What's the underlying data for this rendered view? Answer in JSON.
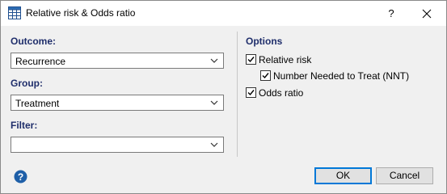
{
  "window": {
    "title": "Relative risk & Odds ratio",
    "help_label": "?"
  },
  "left": {
    "outcome": {
      "label": "Outcome:",
      "value": "Recurrence"
    },
    "group": {
      "label": "Group:",
      "value": "Treatment"
    },
    "filter": {
      "label": "Filter:",
      "value": ""
    }
  },
  "options": {
    "heading": "Options",
    "items": [
      {
        "label": "Relative risk",
        "checked": true
      },
      {
        "label": "Number Needed to Treat (NNT)",
        "checked": true
      },
      {
        "label": "Odds ratio",
        "checked": true
      }
    ]
  },
  "buttons": {
    "ok": "OK",
    "cancel": "Cancel"
  },
  "colors": {
    "accent": "#1f2e6b",
    "default_button_border": "#0078d7",
    "help_icon": "#1e5fa8"
  }
}
